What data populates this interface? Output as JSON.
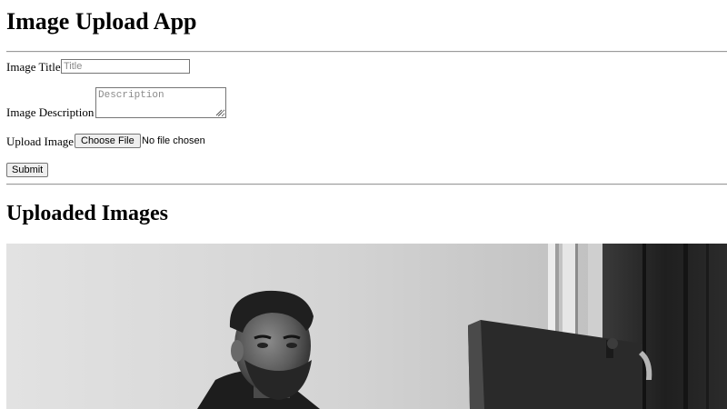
{
  "app": {
    "title": "Image Upload App"
  },
  "form": {
    "title_label": "Image Title",
    "title_placeholder": "Title",
    "title_value": "",
    "description_label": "Image Description",
    "description_placeholder": "Description",
    "description_value": "",
    "upload_label": "Upload Image",
    "choose_file_label": "Choose File",
    "file_status": "No file chosen",
    "submit_label": "Submit"
  },
  "uploaded": {
    "heading": "Uploaded Images",
    "images": [
      {
        "style": "black-and-white photo",
        "icon": "photo-thumbnail"
      }
    ]
  }
}
